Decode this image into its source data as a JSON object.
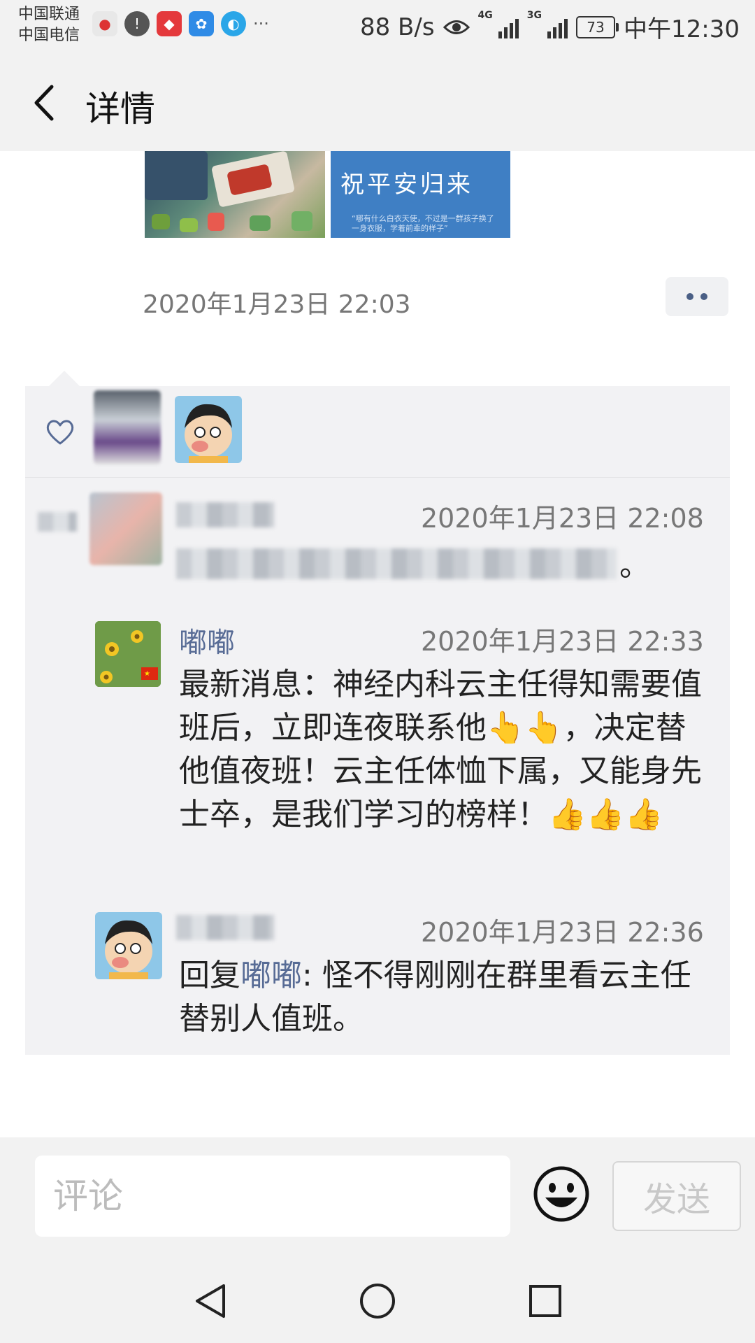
{
  "status_bar": {
    "carrier_1": "中国联通",
    "carrier_2": "中国电信",
    "net_speed": "88 B/s",
    "net_1": "4G",
    "net_2": "3G",
    "battery": "73",
    "time": "中午12:30",
    "more": "···"
  },
  "header": {
    "title": "详情"
  },
  "post": {
    "image_2_text": "祝平安归来",
    "image_2_caption": "“哪有什么白衣天使，不过是一群孩子换了一身衣服，学着前辈的样子”",
    "time": "2020年1月23日 22:03"
  },
  "comments": [
    {
      "name": "",
      "time": "2020年1月23日 22:08",
      "text": "。"
    },
    {
      "name": "嘟嘟",
      "time": "2020年1月23日 22:33",
      "text": "最新消息：神经内科云主任得知需要值班后，立即连夜联系他👆👆，决定替他值夜班！云主任体恤下属，又能身先士卒，是我们学习的榜样！👍👍👍"
    },
    {
      "name": "",
      "time": "2020年1月23日 22:36",
      "reply_prefix": "回复",
      "reply_to": "嘟嘟",
      "text": ": 怪不得刚刚在群里看云主任替别人值班。"
    }
  ],
  "footer": {
    "comment_placeholder": "评论",
    "send_label": "发送"
  },
  "icons": {
    "back": "back-chevron-icon",
    "heart": "heart-icon",
    "more": "more-dots-icon",
    "emoji": "smiley-icon",
    "nav_back": "triangle-back-icon",
    "nav_home": "circle-home-icon",
    "nav_recent": "square-recent-icon"
  },
  "colors": {
    "link": "#576b95",
    "bar_bg": "#f2f2f2",
    "comment_bg": "#f2f2f4"
  }
}
